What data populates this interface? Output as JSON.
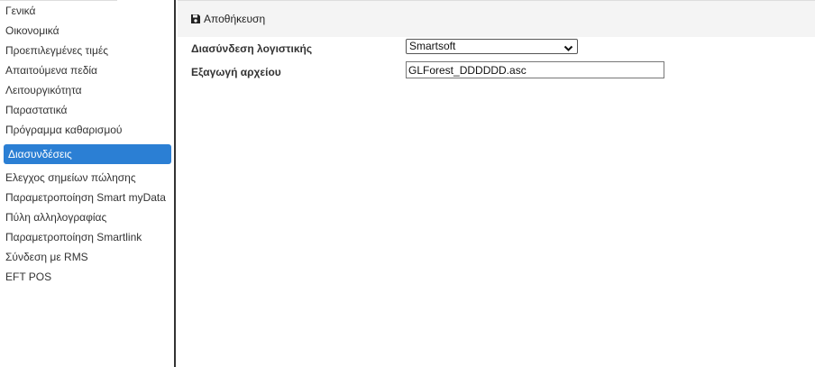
{
  "sidebar": {
    "items": [
      {
        "label": "Γενικά",
        "active": false
      },
      {
        "label": "Οικονομικά",
        "active": false
      },
      {
        "label": "Προεπιλεγμένες τιμές",
        "active": false
      },
      {
        "label": "Απαιτούμενα πεδία",
        "active": false
      },
      {
        "label": "Λειτουργικότητα",
        "active": false
      },
      {
        "label": "Παραστατικά",
        "active": false
      },
      {
        "label": "Πρόγραμμα καθαρισμού",
        "active": false
      },
      {
        "label": "Διασυνδέσεις",
        "active": true
      },
      {
        "label": "Ελεγχος σημείων πώλησης",
        "active": false
      },
      {
        "label": "Παραμετροποίηση Smart myData",
        "active": false
      },
      {
        "label": "Πύλη αλληλογραφίας",
        "active": false
      },
      {
        "label": "Παραμετροποίηση Smartlink",
        "active": false
      },
      {
        "label": "Σύνδεση με RMS",
        "active": false
      },
      {
        "label": "EFT POS",
        "active": false
      }
    ]
  },
  "toolbar": {
    "save_label": "Αποθήκευση",
    "save_icon": "floppy-disk-icon"
  },
  "form": {
    "accounting_link": {
      "label": "Διασύνδεση λογιστικής",
      "selected": "Smartsoft"
    },
    "file_export": {
      "label": "Εξαγωγή αρχείου",
      "value": "GLForest_DDDDDD.asc"
    }
  },
  "colors": {
    "active_item_bg": "#2b7fd4",
    "toolbar_bg": "#f4f4f4",
    "sidebar_border": "#333333"
  }
}
